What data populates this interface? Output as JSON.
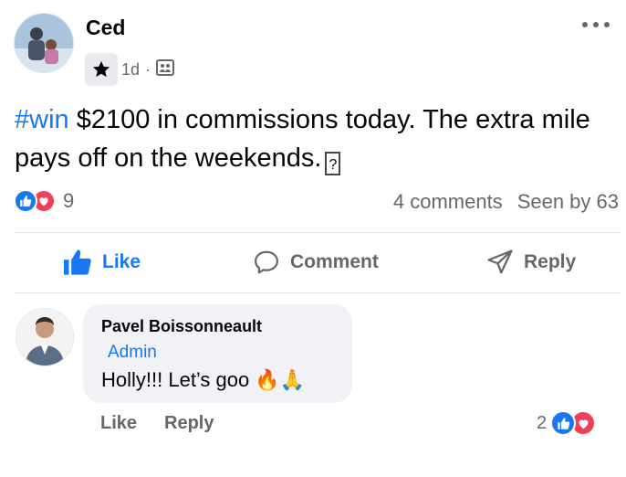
{
  "post": {
    "author": "Ced",
    "time": "1d",
    "separator": "·",
    "hashtag": "#win",
    "text": " $2100 in commissions today. The extra mile pays off on the weekends.",
    "unknown_glyph": "?"
  },
  "reactions": {
    "count": "9",
    "comments": "4 comments",
    "seen": "Seen by 63"
  },
  "actions": {
    "like": "Like",
    "comment": "Comment",
    "reply": "Reply"
  },
  "comment": {
    "author": "Pavel Boissonneault",
    "role": "Admin",
    "text": "Holly!!! Let’s goo",
    "emojis": "🔥🙏",
    "like": "Like",
    "reply": "Reply",
    "reaction_count": "2"
  },
  "colors": {
    "accent": "#1877f2",
    "love": "#f33e58",
    "muted": "#65676b",
    "bubble": "#f0f2f5"
  }
}
